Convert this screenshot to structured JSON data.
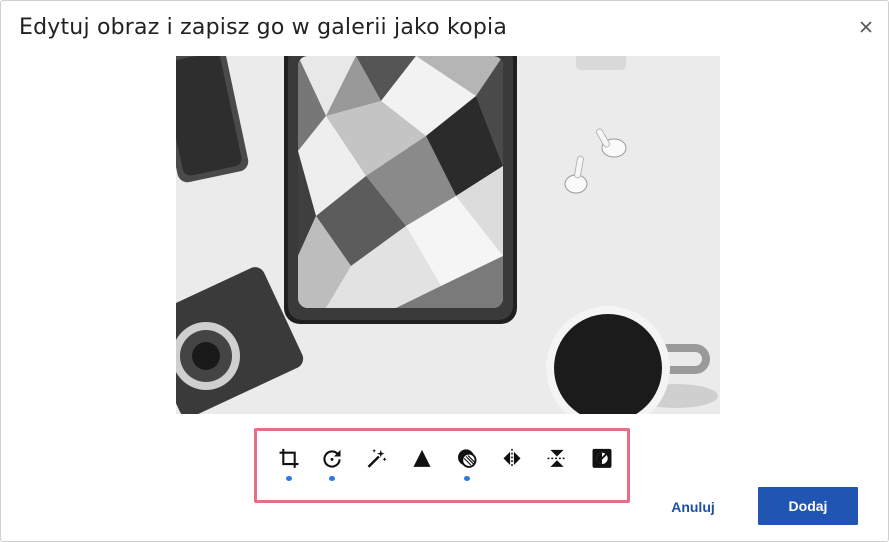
{
  "dialog": {
    "title": "Edytuj obraz i zapisz go w galerii jako kopia",
    "close_icon": "close-icon"
  },
  "image": {
    "icon": "photo-preview"
  },
  "toolbar": {
    "tools": [
      {
        "icon": "crop-icon",
        "active": true
      },
      {
        "icon": "rotate-icon",
        "active": true
      },
      {
        "icon": "magic-wand-icon",
        "active": false
      },
      {
        "icon": "sharpen-triangle-icon",
        "active": false
      },
      {
        "icon": "filter-icon",
        "active": true
      },
      {
        "icon": "flip-horizontal-icon",
        "active": false
      },
      {
        "icon": "flip-vertical-icon",
        "active": false
      },
      {
        "icon": "invert-icon",
        "active": false
      }
    ],
    "accent_color": "#2a7ae4",
    "highlight_color": "#e66e86"
  },
  "actions": {
    "cancel_label": "Anuluj",
    "add_label": "Dodaj",
    "primary_color": "#2155b4"
  }
}
